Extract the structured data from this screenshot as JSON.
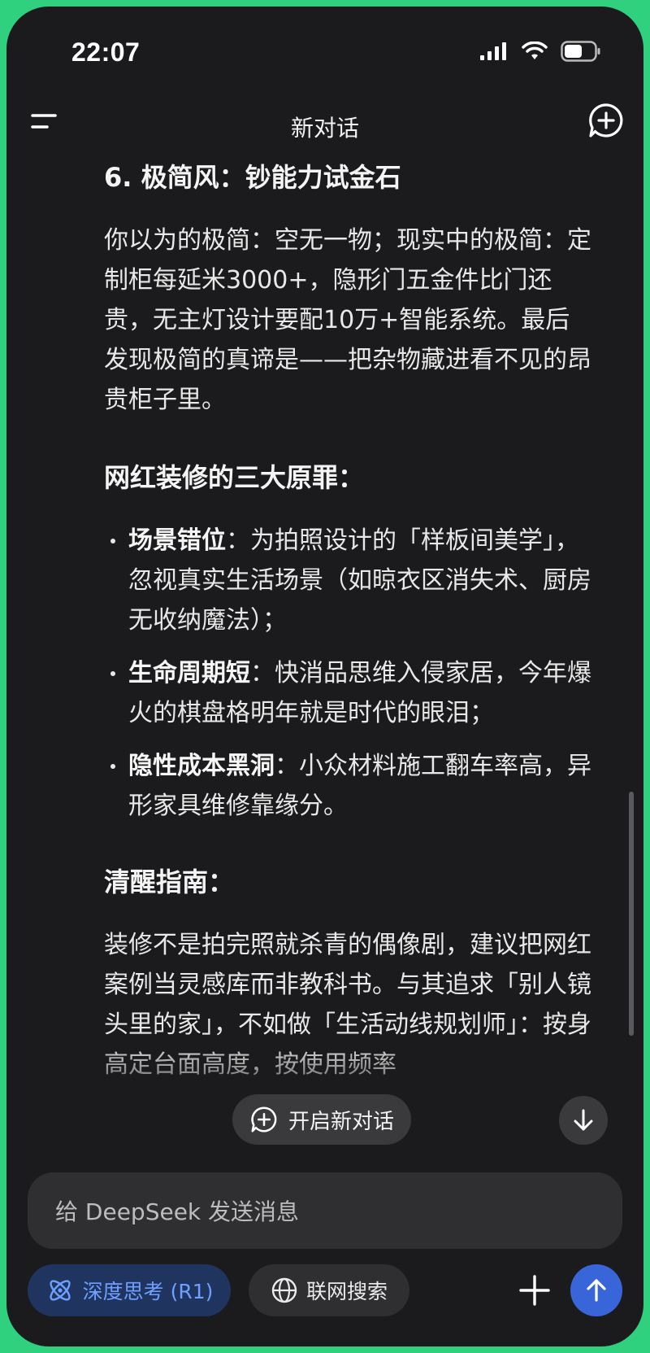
{
  "status_bar": {
    "time": "22:07"
  },
  "header": {
    "title": "新对话"
  },
  "content": {
    "section6_heading": "6. 极简风：钞能力试金石",
    "section6_body": "你以为的极简：空无一物；现实中的极简：定制柜每延米3000+，隐形门五金件比门还贵，无主灯设计要配10万+智能系统。最后发现极简的真谛是——把杂物藏进看不见的昂贵柜子里。",
    "sins_heading": "网红装修的三大原罪：",
    "sins": [
      {
        "title": "场景错位",
        "text": "：为拍照设计的「样板间美学」，忽视真实生活场景（如晾衣区消失术、厨房无收纳魔法）；"
      },
      {
        "title": "生命周期短",
        "text": "：快消品思维入侵家居，今年爆火的棋盘格明年就是时代的眼泪；"
      },
      {
        "title": "隐性成本黑洞",
        "text": "：小众材料施工翻车率高，异形家具维修靠缘分。"
      }
    ],
    "guide_heading": "清醒指南：",
    "guide_body": "装修不是拍完照就杀青的偶像剧，建议把网红案例当灵感库而非教科书。与其追求「别人镜头里的家」，不如做「生活动线规划师」：按身高定台面高度，按使用频率"
  },
  "new_chat_pill": {
    "label": "开启新对话"
  },
  "composer": {
    "placeholder": "给 DeepSeek 发送消息",
    "deep_think_label": "深度思考 (R1)",
    "web_search_label": "联网搜索"
  },
  "colors": {
    "background": "#1b1b1d",
    "accent_blue": "#3866d8",
    "deep_think_text": "#6ea0ff",
    "frame_green": "#2fd17f"
  }
}
